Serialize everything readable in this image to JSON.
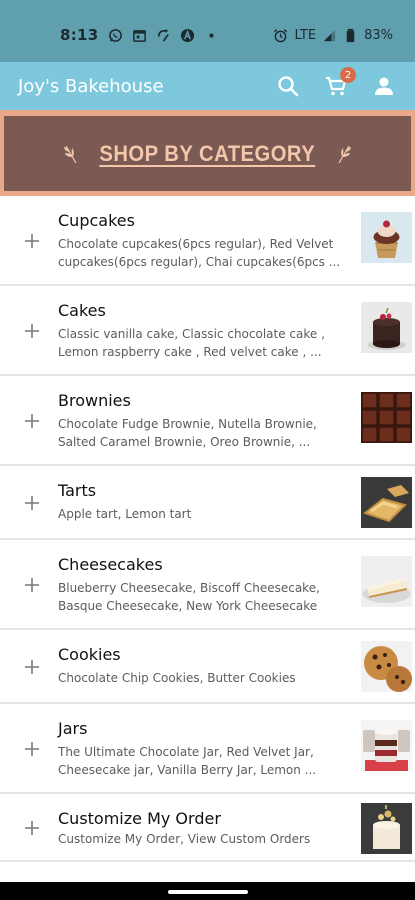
{
  "status_bar": {
    "time": "8:13",
    "network": "LTE",
    "battery": "83%",
    "left_icons": [
      "whatsapp-icon",
      "calendar-icon",
      "sync-icon",
      "a-icon",
      "dot-icon"
    ],
    "right_icons": [
      "alarm-icon",
      "signal-icon",
      "battery-icon"
    ]
  },
  "app_bar": {
    "title": "Joy's Bakehouse",
    "cart_count": "2",
    "icons": [
      "search-icon",
      "cart-icon",
      "account-icon"
    ],
    "color": "#7ec8dd"
  },
  "banner": {
    "title": "SHOP BY CATEGORY",
    "background": "#7a5a52",
    "border_color": "#eaa88b",
    "text_color": "#f4c7ad"
  },
  "categories": [
    {
      "name": "Cupcakes",
      "description": "Chocolate cupcakes(6pcs regular), Red Velvet cupcakes(6pcs regular), Chai cupcakes(6pcs ...",
      "thumbnail": "cupcake"
    },
    {
      "name": "Cakes",
      "description": "Classic vanilla cake, Classic chocolate cake , Lemon raspberry cake , Red velvet cake , ...",
      "thumbnail": "cake"
    },
    {
      "name": "Brownies",
      "description": "Chocolate Fudge Brownie, Nutella Brownie, Salted Caramel Brownie, Oreo Brownie, ...",
      "thumbnail": "brownie"
    },
    {
      "name": "Tarts",
      "description": "Apple tart, Lemon tart",
      "thumbnail": "tart"
    },
    {
      "name": "Cheesecakes",
      "description": "Blueberry Cheesecake, Biscoff Cheesecake, Basque Cheesecake, New York Cheesecake",
      "thumbnail": "cheesecake"
    },
    {
      "name": "Cookies",
      "description": "Chocolate Chip Cookies, Butter Cookies",
      "thumbnail": "cookie"
    },
    {
      "name": "Jars",
      "description": "The Ultimate Chocolate Jar, Red Velvet Jar, Cheesecake jar, Vanilla Berry Jar, Lemon ...",
      "thumbnail": "jar"
    },
    {
      "name": "Customize My Order",
      "description": "Customize My Order, View Custom Orders",
      "thumbnail": "custom"
    }
  ]
}
